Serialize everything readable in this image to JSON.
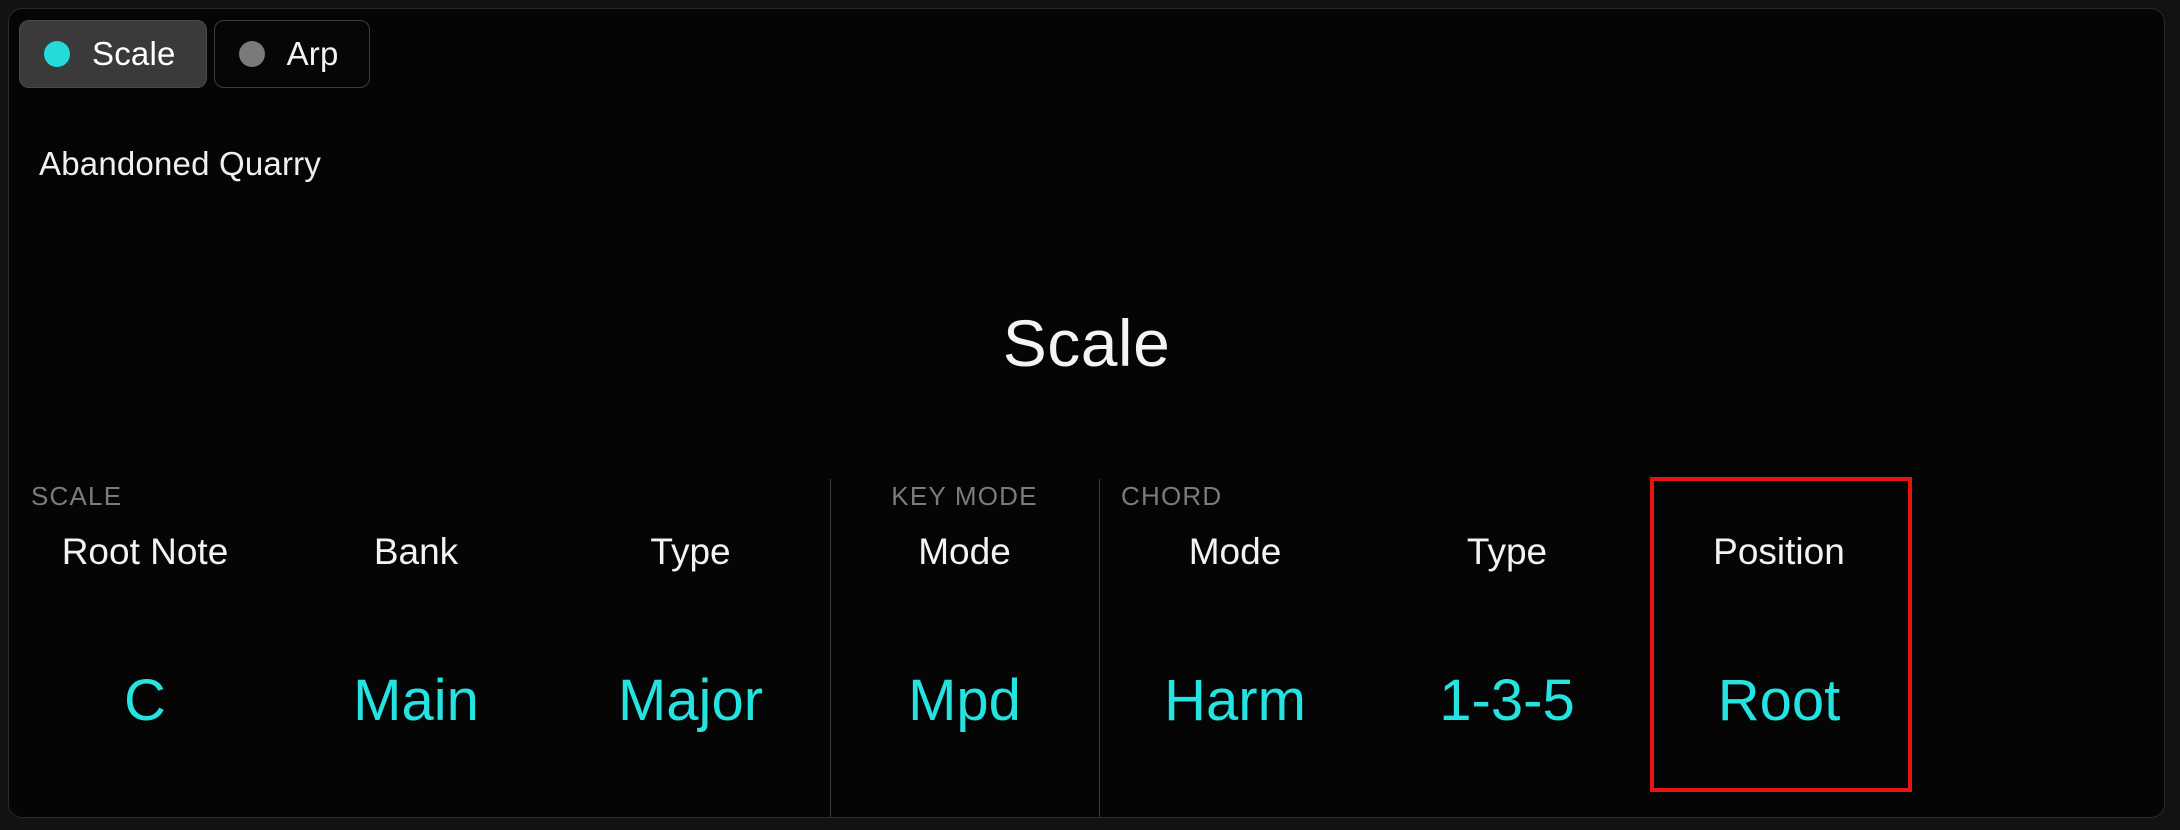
{
  "panel": {
    "background_color": "#050505",
    "accent_color": "#25e3e0",
    "highlight_color": "#e81414"
  },
  "tabs": [
    {
      "label": "Scale",
      "dot": "status-dot",
      "active": true,
      "dot_color": "#24dbd8"
    },
    {
      "label": "Arp",
      "dot": "status-dot",
      "active": false,
      "dot_color": "#7a7a7a"
    }
  ],
  "preset": {
    "name": "Abandoned Quarry"
  },
  "page": {
    "title": "Scale"
  },
  "groups": [
    {
      "label": "SCALE"
    },
    {
      "label": "KEY MODE"
    },
    {
      "label": "CHORD"
    }
  ],
  "columns": [
    {
      "header": "Root Note",
      "value": "C",
      "group": "SCALE",
      "highlighted": false
    },
    {
      "header": "Bank",
      "value": "Main",
      "group": "SCALE",
      "highlighted": false
    },
    {
      "header": "Type",
      "value": "Major",
      "group": "SCALE",
      "highlighted": false
    },
    {
      "header": "Mode",
      "value": "Mpd",
      "group": "KEY MODE",
      "highlighted": false
    },
    {
      "header": "Mode",
      "value": "Harm",
      "group": "CHORD",
      "highlighted": false
    },
    {
      "header": "Type",
      "value": "1-3-5",
      "group": "CHORD",
      "highlighted": false
    },
    {
      "header": "Position",
      "value": "Root",
      "group": "CHORD",
      "highlighted": true
    }
  ]
}
